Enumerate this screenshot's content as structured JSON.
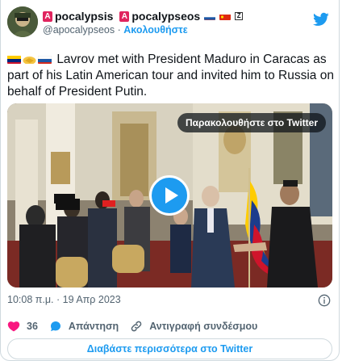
{
  "author": {
    "name_part1": "pocalypsis",
    "name_part2": "pocalypseos",
    "badge_letter": "A",
    "handle": "@apocalypseos",
    "separator": "·",
    "follow_label": "Ακολουθήστε"
  },
  "tweet": {
    "text": "Lavrov met with President Maduro in Caracas as part of his Latin American tour and invited him to Russia on behalf of President Putin."
  },
  "media": {
    "watch_label": "Παρακολουθήστε στο Twitter"
  },
  "meta": {
    "timestamp": "10:08 π.μ. · 19 Απρ 2023"
  },
  "actions": {
    "like_count": "36",
    "reply_label": "Απάντηση",
    "copy_link_label": "Αντιγραφή συνδέσμου"
  },
  "read_more_label": "Διαβάστε περισσότερα στο Twitter",
  "colors": {
    "accent": "#1d9bf0",
    "like": "#f91880",
    "badge": "#e0245e"
  },
  "icons": [
    "twitter-bird-icon",
    "venezuela-flag-icon",
    "handshake-icon",
    "russia-flag-icon",
    "china-flag-icon",
    "play-icon",
    "info-icon",
    "heart-icon",
    "reply-bubble-icon",
    "link-icon"
  ]
}
